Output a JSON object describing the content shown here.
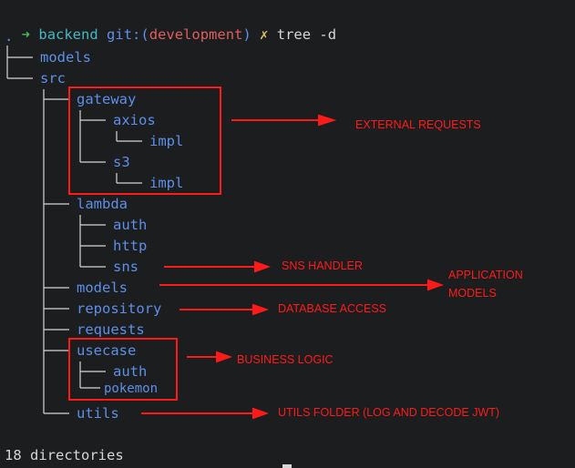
{
  "prompt": {
    "arrow": "➜",
    "dir": "backend",
    "git_label": "git:(",
    "branch": "development",
    "git_close": ")",
    "dirty": "✗",
    "command": "tree -d"
  },
  "tree": {
    "root": ".",
    "items": [
      {
        "name": "models"
      },
      {
        "name": "src"
      },
      {
        "name": "gateway"
      },
      {
        "name": "axios"
      },
      {
        "name": "impl"
      },
      {
        "name": "s3"
      },
      {
        "name": "impl"
      },
      {
        "name": "lambda"
      },
      {
        "name": "auth"
      },
      {
        "name": "http"
      },
      {
        "name": "sns"
      },
      {
        "name": "models"
      },
      {
        "name": "repository"
      },
      {
        "name": "requests"
      },
      {
        "name": "usecase"
      },
      {
        "name": "auth"
      },
      {
        "name": "pokemon"
      },
      {
        "name": "utils"
      }
    ]
  },
  "summary": "18 directories",
  "annotations": {
    "external_requests": "EXTERNAL REQUESTS",
    "sns_handler": "SNS HANDLER",
    "application_models": "APPLICATION MODELS",
    "database_access": "DATABASE ACCESS",
    "business_logic": "BUSINESS LOGIC",
    "utils_folder": "UTILS FOLDER (LOG AND DECODE JWT)"
  },
  "colors": {
    "background": "#1c1d1f",
    "directory": "#5d8fe8",
    "annotation": "#ff1a1a",
    "prompt_arrow": "#3fbf5a",
    "prompt_dir": "#3fb9c5",
    "branch": "#e05d5d"
  }
}
